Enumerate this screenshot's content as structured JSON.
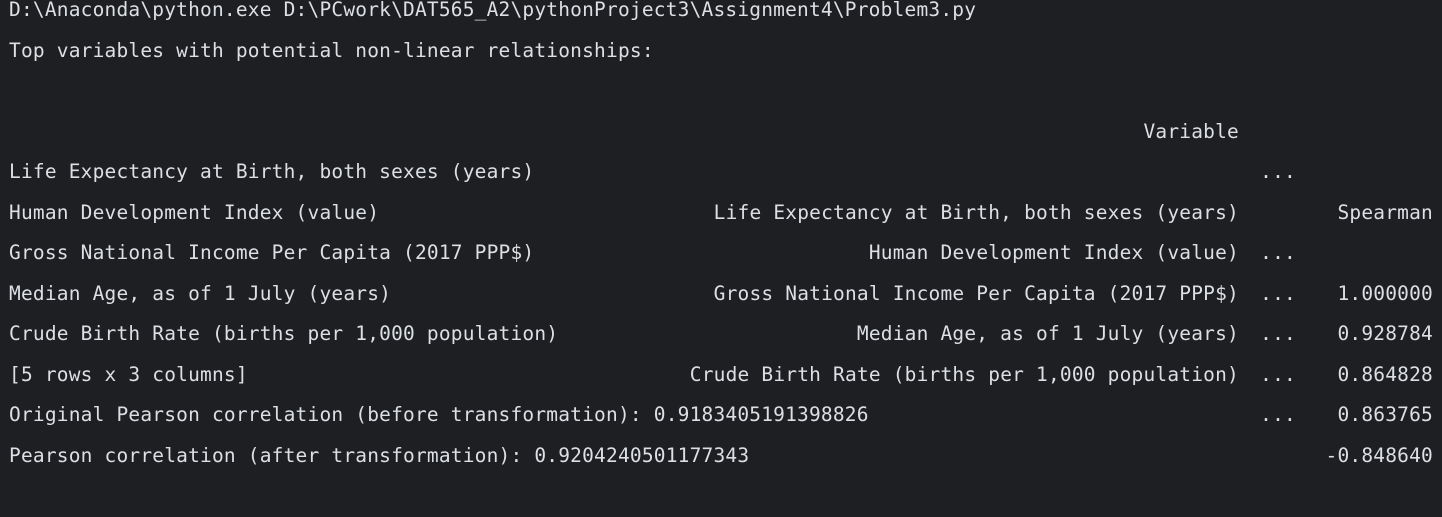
{
  "console": {
    "command_line": "D:\\Anaconda\\python.exe D:\\PCwork\\DAT565_A2\\pythonProject3\\Assignment4\\Problem3.py",
    "heading": "Top variables with potential non-linear relationships:",
    "table": {
      "columns": [
        "Variable",
        "...",
        "Spearman"
      ],
      "rows": [
        {
          "index": "Life Expectancy at Birth, both sexes (years)",
          "variable": "Life Expectancy at Birth, both sexes (years)",
          "ellipsis": "...",
          "spearman": "1.000000"
        },
        {
          "index": "Human Development Index (value)",
          "variable": "Human Development Index (value)",
          "ellipsis": "...",
          "spearman": "0.928784"
        },
        {
          "index": "Gross National Income Per Capita (2017 PPP$)",
          "variable": "Gross National Income Per Capita (2017 PPP$)",
          "ellipsis": "...",
          "spearman": "0.864828"
        },
        {
          "index": "Median Age, as of 1 July (years)",
          "variable": "Median Age, as of 1 July (years)",
          "ellipsis": "...",
          "spearman": "0.863765"
        },
        {
          "index": "Crude Birth Rate (births per 1,000 population)",
          "variable": "Crude Birth Rate (births per 1,000 population)",
          "ellipsis": "...",
          "spearman": "-0.848640"
        }
      ],
      "shape_note": "[5 rows x 3 columns]"
    },
    "pearson_before": "Original Pearson correlation (before transformation): 0.9183405191398826",
    "pearson_after": "Pearson correlation (after transformation): 0.9204240501177343"
  }
}
